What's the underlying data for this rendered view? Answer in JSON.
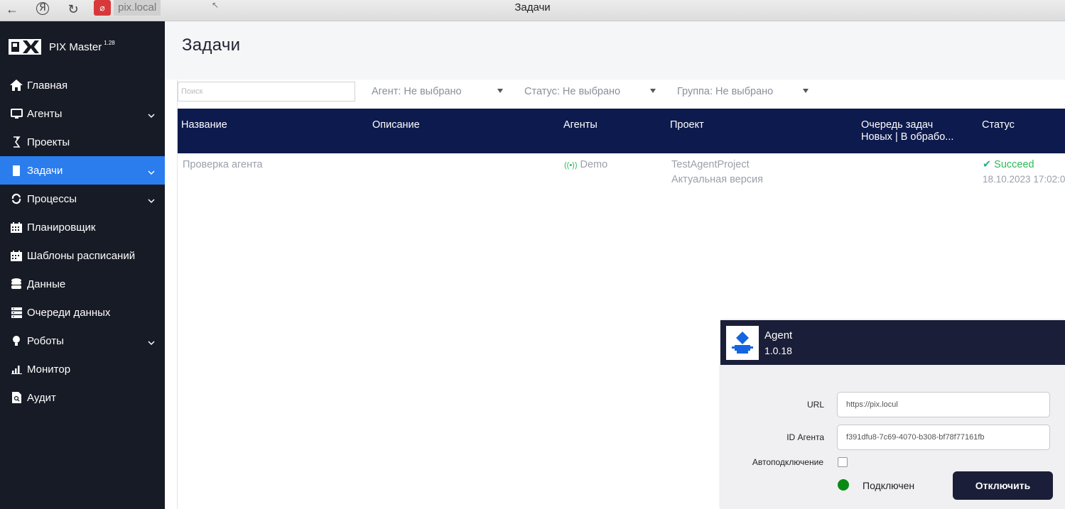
{
  "browser": {
    "url": "pix.local",
    "window_title": "Задачи"
  },
  "brand": {
    "name": "PIX Master",
    "version": "1.28"
  },
  "sidebar": {
    "items": [
      {
        "label": "Главная",
        "icon": "home-icon",
        "has_chevron": false,
        "active": false
      },
      {
        "label": "Агенты",
        "icon": "monitor-icon",
        "has_chevron": true,
        "active": false
      },
      {
        "label": "Проекты",
        "icon": "project-icon",
        "has_chevron": false,
        "active": false
      },
      {
        "label": "Задачи",
        "icon": "task-icon",
        "has_chevron": true,
        "active": true
      },
      {
        "label": "Процессы",
        "icon": "refresh-icon",
        "has_chevron": true,
        "active": false
      },
      {
        "label": "Планировщик",
        "icon": "calendar-icon",
        "has_chevron": false,
        "active": false
      },
      {
        "label": "Шаблоны расписаний",
        "icon": "calendar-template-icon",
        "has_chevron": false,
        "active": false
      },
      {
        "label": "Данные",
        "icon": "database-icon",
        "has_chevron": false,
        "active": false
      },
      {
        "label": "Очереди данных",
        "icon": "queue-icon",
        "has_chevron": false,
        "active": false
      },
      {
        "label": "Роботы",
        "icon": "robot-icon",
        "has_chevron": true,
        "active": false
      },
      {
        "label": "Монитор",
        "icon": "chart-icon",
        "has_chevron": false,
        "active": false
      },
      {
        "label": "Аудит",
        "icon": "audit-icon",
        "has_chevron": false,
        "active": false
      }
    ]
  },
  "page": {
    "title": "Задачи"
  },
  "filters": {
    "search_placeholder": "Поиск",
    "agent": "Агент: Не выбрано",
    "status": "Статус: Не выбрано",
    "group": "Группа: Не выбрано"
  },
  "table": {
    "columns": {
      "name": "Название",
      "description": "Описание",
      "agents": "Агенты",
      "project": "Проект",
      "queue_line1": "Очередь задач",
      "queue_line2": "Новых | В обрабо...",
      "status": "Статус"
    },
    "rows": [
      {
        "name": "Проверка агента",
        "description": "",
        "agent": "Demo",
        "project": "TestAgentProject",
        "project_version": "Актуальная версия",
        "queue": "",
        "status": "Succeed",
        "status_time": "18.10.2023 17:02:0"
      }
    ]
  },
  "agent_panel": {
    "name": "Agent",
    "version": "1.0.18",
    "url_label": "URL",
    "url_value": "https://pix.locul",
    "id_label": "ID Агента",
    "id_value": "f391dfu8-7c69-4070-b308-bf78f77161fb",
    "autoconnect_label": "Автоподключение",
    "autoconnect_checked": false,
    "connection_status": "Подключен",
    "disconnect_label": "Отключить"
  },
  "colors": {
    "sidebar_bg": "#171b25",
    "active_item": "#2b7ded",
    "table_header": "#0d1a4d",
    "success": "#2eb85c",
    "agent_header": "#1a1e38",
    "connected_dot": "#0a8a14"
  }
}
